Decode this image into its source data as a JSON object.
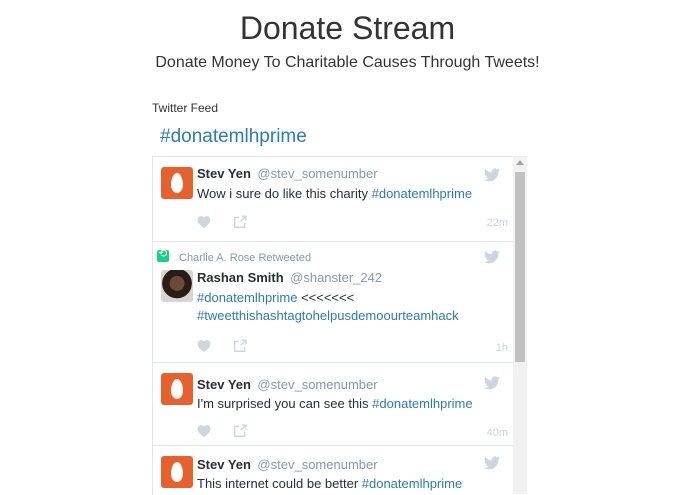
{
  "page": {
    "title": "Donate Stream",
    "subtitle": "Donate Money To Charitable Causes Through Tweets!"
  },
  "feed": {
    "label": "Twitter Feed",
    "hashtag": "#donatemlhprime"
  },
  "tweets": [
    {
      "name": "Stev Yen",
      "handle": "@stev_somenumber",
      "text": "Wow i sure do like this charity ",
      "link": "#donatemlhprime",
      "time": "22m",
      "avatar": "egg"
    },
    {
      "retweeted_by": "Charlie A. Rose Retweeted",
      "name": "Rashan Smith",
      "handle": "@shanster_242",
      "link1": "#donatemlhprime",
      "text": " <<<<<<<",
      "link2": "#tweetthishashtagtohelpusdemoourteamhack",
      "time": "1h",
      "avatar": "photo"
    },
    {
      "name": "Stev Yen",
      "handle": "@stev_somenumber",
      "text": "I'm surprised you can see this ",
      "link": "#donatemlhprime",
      "time": "40m",
      "avatar": "egg"
    },
    {
      "name": "Stev Yen",
      "handle": "@stev_somenumber",
      "text": "This internet could be better ",
      "link": "#donatemlhprime",
      "avatar": "egg"
    }
  ],
  "colors": {
    "link": "#2b7bb9",
    "egg_avatar": "#e8602c",
    "retweet": "#19cf86"
  },
  "icons": [
    "twitter-bird-icon",
    "heart-icon",
    "share-icon",
    "retweet-icon"
  ]
}
